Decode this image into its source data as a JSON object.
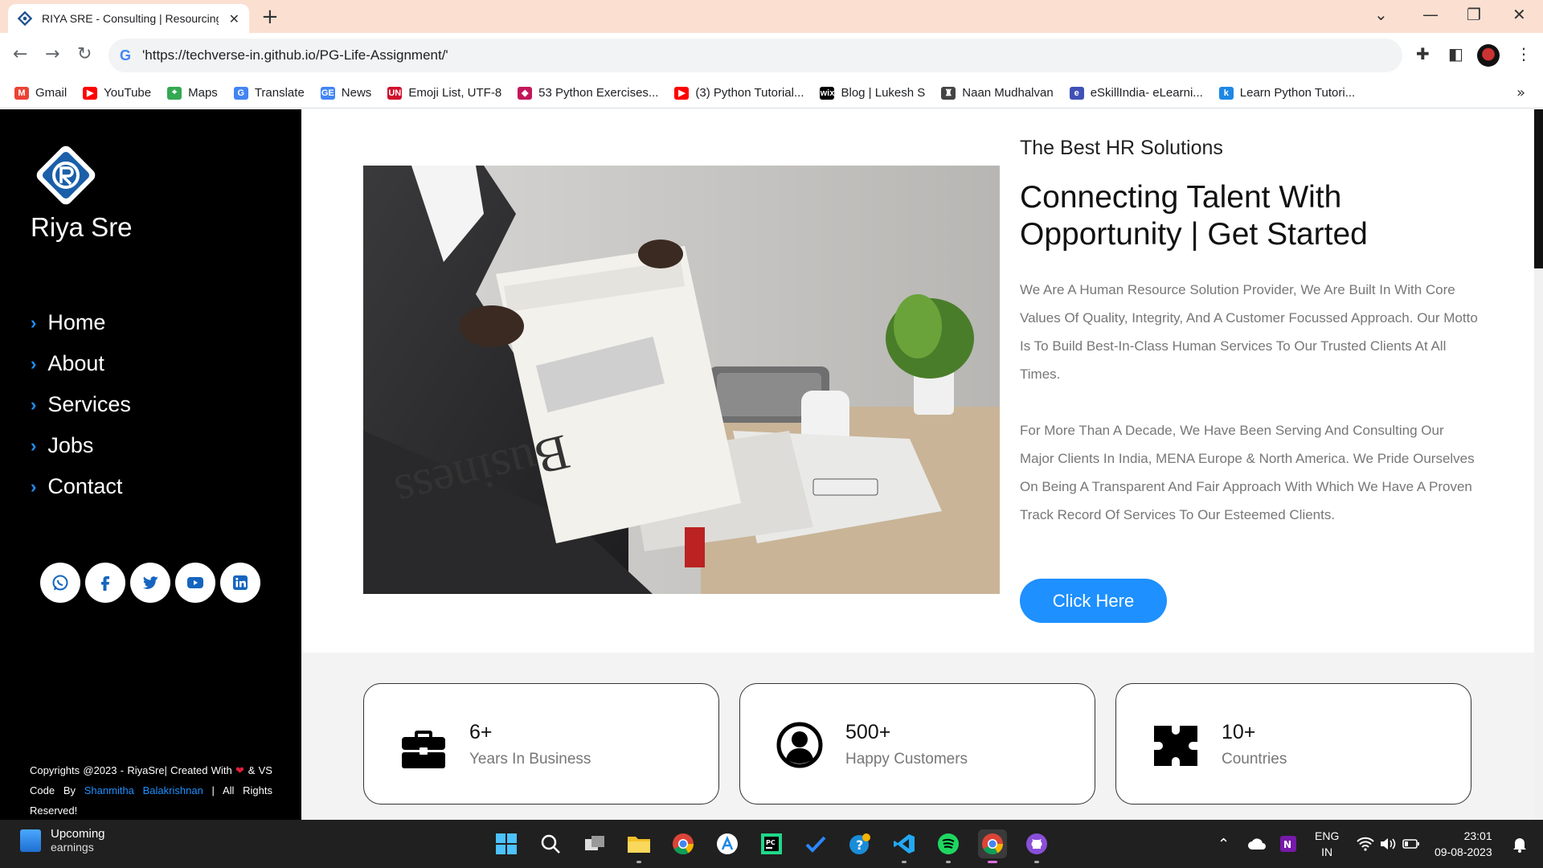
{
  "browser": {
    "tab_title": "RIYA SRE - Consulting | Resourcing",
    "tab_close": "✕",
    "new_tab": "+",
    "url": "'https://techverse-in.github.io/PG-Life-Assignment/'",
    "bookmarks": [
      {
        "label": "Gmail",
        "icon": "gmail-icon",
        "color": "#ea4335",
        "glyph": "M"
      },
      {
        "label": "YouTube",
        "icon": "youtube-icon",
        "color": "#ff0000",
        "glyph": "▶"
      },
      {
        "label": "Maps",
        "icon": "maps-icon",
        "color": "#34a853",
        "glyph": "⌖"
      },
      {
        "label": "Translate",
        "icon": "translate-icon",
        "color": "#4285f4",
        "glyph": "G"
      },
      {
        "label": "News",
        "icon": "news-icon",
        "color": "#4285f4",
        "glyph": "GE"
      },
      {
        "label": "Emoji List, UTF-8",
        "icon": "emoji-list-icon",
        "color": "#d0102c",
        "glyph": "UN"
      },
      {
        "label": "53 Python Exercises...",
        "icon": "gem-icon",
        "color": "#c2185b",
        "glyph": "◆"
      },
      {
        "label": "(3) Python Tutorial...",
        "icon": "youtube-icon",
        "color": "#ff0000",
        "glyph": "▶"
      },
      {
        "label": "Blog | Lukesh S",
        "icon": "wix-icon",
        "color": "#000000",
        "glyph": "wix"
      },
      {
        "label": "Naan Mudhalvan",
        "icon": "graduation-icon",
        "color": "#444444",
        "glyph": "♜"
      },
      {
        "label": "eSkillIndia- eLearni...",
        "icon": "eskill-icon",
        "color": "#3f51b5",
        "glyph": "e"
      },
      {
        "label": "Learn Python Tutori...",
        "icon": "k-icon",
        "color": "#1e88e5",
        "glyph": "k"
      }
    ],
    "bookmarks_more": "»"
  },
  "sidebar": {
    "brand": "Riya Sre",
    "nav": [
      {
        "label": "Home"
      },
      {
        "label": "About"
      },
      {
        "label": "Services"
      },
      {
        "label": "Jobs"
      },
      {
        "label": "Contact"
      }
    ],
    "socials": [
      "whatsapp-icon",
      "facebook-icon",
      "twitter-icon",
      "youtube-icon",
      "linkedin-icon"
    ],
    "copyright_pre": "Copyrights @2023 - RiyaSre| Created With",
    "copyright_mid": "& VS Code By",
    "copyright_author": "Shanmitha Balakrishnan",
    "copyright_post": "| All Rights Reserved!"
  },
  "hero": {
    "image_word": "Business",
    "tagline": "The Best HR Solutions",
    "headline": "Connecting Talent With Opportunity | Get Started",
    "paragraph_1": "We Are A Human Resource Solution Provider, We Are Built In With Core Values Of Quality, Integrity, And A Customer Focussed Approach. Our Motto Is To Build Best-In-Class Human Services To Our Trusted Clients At All Times.",
    "paragraph_2": "For More Than A Decade, We Have Been Serving And Consulting Our Major Clients In India, MENA Europe & North America. We Pride Ourselves On Being A Transparent And Fair Approach With Which We Have A Proven Track Record Of Services To Our Esteemed Clients.",
    "cta": "Click Here"
  },
  "stats": [
    {
      "number": "6+",
      "label": "Years In Business",
      "icon": "briefcase-icon"
    },
    {
      "number": "500+",
      "label": "Happy Customers",
      "icon": "user-circle-icon"
    },
    {
      "number": "10+",
      "label": "Countries",
      "icon": "puzzle-icon"
    }
  ],
  "taskbar": {
    "weather_title": "Upcoming",
    "weather_sub": "earnings",
    "lang_1": "ENG",
    "lang_2": "IN",
    "time": "23:01",
    "date": "09-08-2023"
  },
  "colors": {
    "accent": "#1e90ff",
    "sidebar_bg": "#000000",
    "tabstrip_bg": "#fbe0d2",
    "taskbar_bg": "#202020"
  }
}
